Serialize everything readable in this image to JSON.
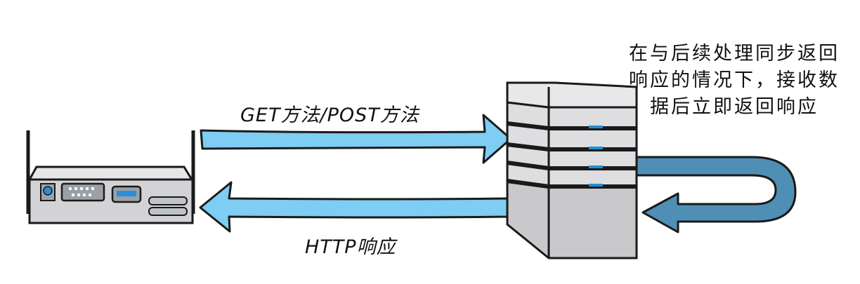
{
  "diagram": {
    "request_label": "GET方法/POST方法",
    "response_label": "HTTP响应",
    "note_lines": [
      "在与后续处理同步返回",
      "响应的情况下，接收数",
      "据后立即返回响应"
    ]
  },
  "colors": {
    "arrow_light_blue": "#7ecdf2",
    "arrow_dark_blue": "#4f8fb5",
    "server_gray": "#c9c9cc",
    "server_light": "#dedee0",
    "led_blue": "#1e8fd6",
    "outline": "#1a1a1a"
  },
  "icons": {
    "client": "router-device-icon",
    "server": "server-stack-icon"
  }
}
